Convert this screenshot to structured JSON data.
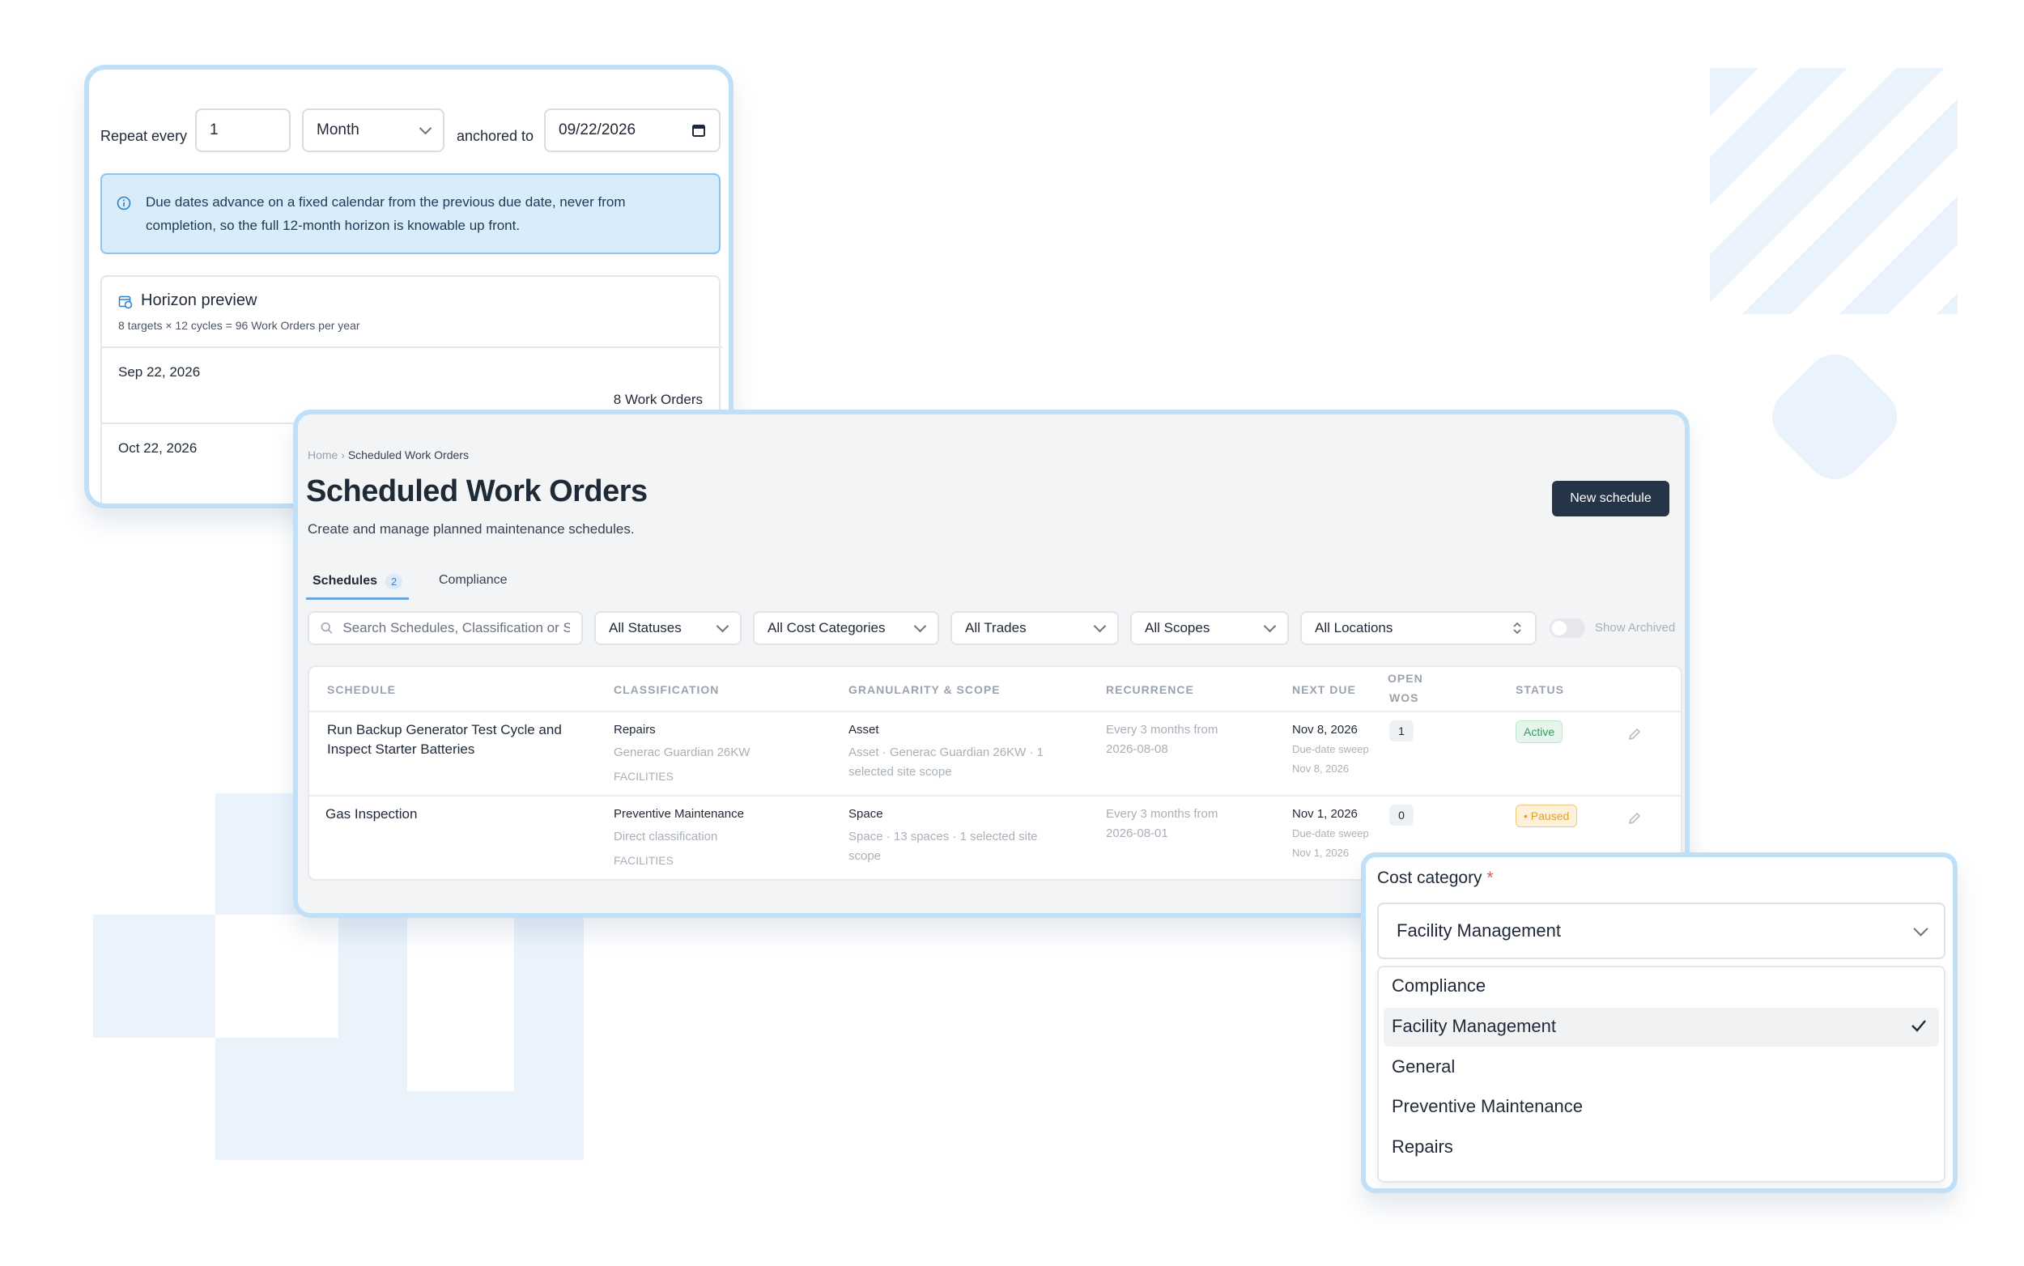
{
  "recurrence_card": {
    "repeat_label": "Repeat every",
    "interval_value": "1",
    "unit_value": "Month",
    "anchored_label": "anchored to",
    "anchor_date": "09/22/2026",
    "info_text_line1": "Due dates advance on a fixed calendar from the previous due date, never from",
    "info_text_line2": "completion, so the full 12-month horizon is knowable up front.",
    "horizon_title": "Horizon preview",
    "horizon_subtitle": "8 targets × 12 cycles = 96 Work Orders per year",
    "horizon_rows": [
      {
        "date": "Sep 22, 2026",
        "count": "8 Work Orders"
      },
      {
        "date": "Oct 22, 2026",
        "count": ""
      }
    ]
  },
  "main": {
    "breadcrumb_home": "Home",
    "breadcrumb_sep": "›",
    "breadcrumb_current": "Scheduled Work Orders",
    "title": "Scheduled Work Orders",
    "subtitle": "Create and manage planned maintenance schedules.",
    "new_button": "New schedule",
    "tabs": [
      {
        "label": "Schedules",
        "badge": "2"
      },
      {
        "label": "Compliance"
      }
    ],
    "search_placeholder": "Search Schedules, Classification or Sc",
    "filters": {
      "status": "All Statuses",
      "cost": "All Cost Categories",
      "trades": "All Trades",
      "scopes": "All Scopes",
      "locations": "All Locations"
    },
    "show_archived": "Show Archived",
    "columns": {
      "schedule": "SCHEDULE",
      "classification": "CLASSIFICATION",
      "granularity": "GRANULARITY & SCOPE",
      "recurrence": "RECURRENCE",
      "next_due": "NEXT DUE",
      "open_wos_1": "OPEN",
      "open_wos_2": "WOS",
      "status": "STATUS"
    },
    "rows": [
      {
        "schedule_line1": "Run Backup Generator Test Cycle and",
        "schedule_line2": "Inspect Starter Batteries",
        "class_main": "Repairs",
        "class_sub": "Generac Guardian 26KW",
        "class_tag": "FACILITIES",
        "gran_main": "Asset",
        "gran_sub1": "Asset · Generac Guardian 26KW · 1",
        "gran_sub2": "selected site scope",
        "rec_line1": "Every 3 months from",
        "rec_line2": "2026-08-08",
        "next_due": "Nov 8, 2026",
        "next_sub1": "Due-date sweep",
        "next_sub2": "Nov 8, 2026",
        "open_wos": "1",
        "status": "Active"
      },
      {
        "schedule_line1": "Gas Inspection",
        "schedule_line2": "",
        "class_main": "Preventive Maintenance",
        "class_sub": "Direct classification",
        "class_tag": "FACILITIES",
        "gran_main": "Space",
        "gran_sub1": "Space · 13 spaces · 1 selected site",
        "gran_sub2": "scope",
        "rec_line1": "Every 3 months from",
        "rec_line2": "2026-08-01",
        "next_due": "Nov 1, 2026",
        "next_sub1": "Due-date sweep",
        "next_sub2": "Nov 1, 2026",
        "open_wos": "0",
        "status": "• Paused"
      }
    ]
  },
  "cost_card": {
    "label": "Cost category",
    "required_mark": "*",
    "selected": "Facility Management",
    "options": [
      "Compliance",
      "Facility Management",
      "General",
      "Preventive Maintenance",
      "Repairs"
    ]
  },
  "colors": {
    "accent_border": "#bfe0f7",
    "decor": "#eaf3fc",
    "button_dark": "#253447",
    "info_bg": "#d9ecfa",
    "active_green": "#2f9e5b",
    "paused_orange": "#e0a030"
  }
}
